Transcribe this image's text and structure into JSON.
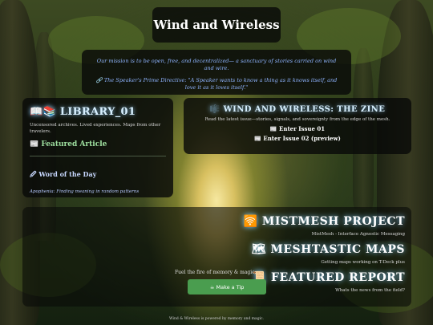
{
  "site": {
    "title": "Wind and Wireless"
  },
  "mission": {
    "statement": "Our mission is to be open, free, and decentralized— a sanctuary of stories carried on wind and wire.",
    "directive_icon": "link-icon",
    "directive": "The Speaker's Prime Directive: \"A Speaker wants to know a thing as it knows itself, and love it as it loves itself.\""
  },
  "library": {
    "icons": "📖📚",
    "heading": "LIBRARY_01",
    "description": "Uncensored archives. Lived experiences. Maps from other travelers.",
    "featured_icon": "📰",
    "featured_label": "Featured Article",
    "word_icon": "🖉",
    "word_heading": "Word of the Day",
    "word_definition": "Apophenia: Finding meaning in random patterns"
  },
  "zine": {
    "icon": "🎼",
    "heading": "WIND AND WIRELESS: THE ZINE",
    "description": "Read the latest issue—stories, signals, and sovereignty from the edge of the mesh.",
    "issue1_icon": "📰",
    "issue1": "Enter Issue 01",
    "issue2_icon": "📰",
    "issue2": "Enter Issue 02 (preview)"
  },
  "projects": [
    {
      "icon": "🛜",
      "title": "MISTMESH PROJECT",
      "subtitle": "MistMesh - Interface Agnostic Messaging"
    },
    {
      "icon": "🗺",
      "title": "MESHTASTIC MAPS",
      "subtitle": "Getting maps working on T-Deck plus"
    },
    {
      "icon": "📜",
      "title": "FEATURED REPORT",
      "subtitle": "Whats the news from the field?"
    }
  ],
  "tip": {
    "prompt": "Fuel the fire of memory & magic:",
    "button_label": "☕ Make a Tip"
  },
  "footer": {
    "text": "Wind & Wireless is powered by memory and magic."
  },
  "colors": {
    "accent_glow": "#8cd2ff",
    "button_green": "#4a9d4f",
    "mission_text": "#8fb4ff"
  }
}
